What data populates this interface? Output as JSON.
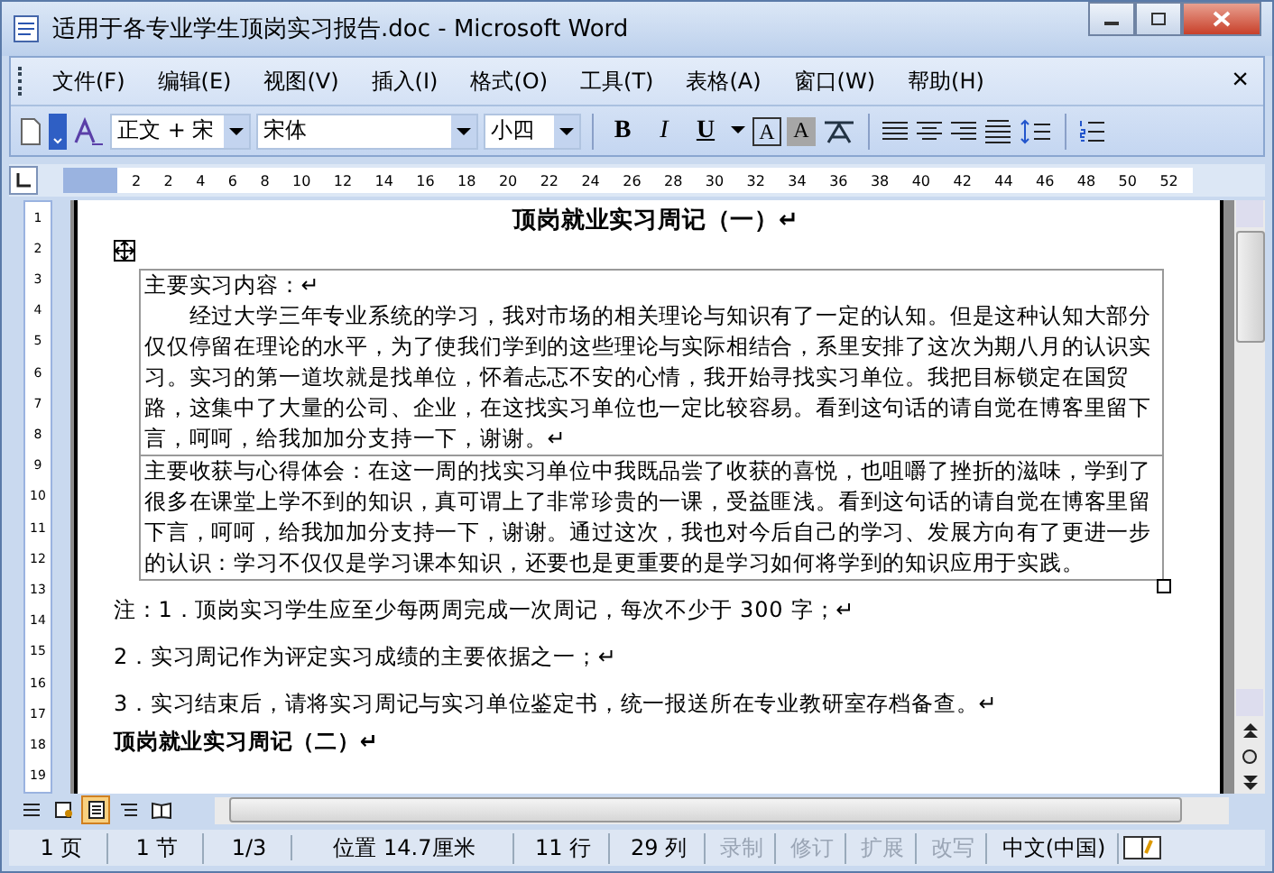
{
  "window": {
    "title": "适用于各专业学生顶岗实习报告.doc - Microsoft Word"
  },
  "menu": [
    {
      "label": "文件(F)"
    },
    {
      "label": "编辑(E)"
    },
    {
      "label": "视图(V)"
    },
    {
      "label": "插入(I)"
    },
    {
      "label": "格式(O)"
    },
    {
      "label": "工具(T)"
    },
    {
      "label": "表格(A)"
    },
    {
      "label": "窗口(W)"
    },
    {
      "label": "帮助(H)"
    }
  ],
  "menu_close": "×",
  "toolbar": {
    "style": "正文 + 宋",
    "font": "宋体",
    "size": "小四",
    "bold": "B",
    "italic": "I",
    "underline": "U",
    "char_border": "A",
    "char_shading": "A"
  },
  "ruler": {
    "ticks": [
      "2",
      "2",
      "4",
      "6",
      "8",
      "10",
      "12",
      "14",
      "16",
      "18",
      "20",
      "22",
      "24",
      "26",
      "28",
      "30",
      "32",
      "34",
      "36",
      "38",
      "40",
      "42",
      "44",
      "46",
      "48",
      "50",
      "52"
    ]
  },
  "vruler": [
    "1",
    "2",
    "3",
    "4",
    "5",
    "6",
    "7",
    "8",
    "9",
    "10",
    "11",
    "12",
    "13",
    "14",
    "15",
    "16",
    "17",
    "18",
    "19"
  ],
  "document": {
    "heading": "顶岗就业实习周记（一）↵",
    "table": [
      {
        "lines": [
          "主要实习内容：↵",
          "　　经过大学三年专业系统的学习，我对市场的相关理论与知识有了一定的认知。但是这种认知大部分仅仅停留在理论的水平，为了使我们学到的这些理论与实际相结合，系里安排了这次为期八月的认识实习。实习的第一道坎就是找单位，怀着忐忑不安的心情，我开始寻找实习单位。我把目标锁定在国贸路，这集中了大量的公司、企业，在这找实习单位也一定比较容易。看到这句话的请自觉在博客里留下言，呵呵，给我加加分支持一下，谢谢。↵"
        ]
      },
      {
        "lines": [
          "主要收获与心得体会：在这一周的找实习单位中我既品尝了收获的喜悦，也咀嚼了挫折的滋味，学到了很多在课堂上学不到的知识，真可谓上了非常珍贵的一课，受益匪浅。看到这句话的请自觉在博客里留下言，呵呵，给我加加分支持一下，谢谢。通过这次，我也对今后自己的学习、发展方向有了更进一步的认识：学习不仅仅是学习课本知识，还要也是更重要的是学习如何将学到的知识应用于实践。"
        ]
      }
    ],
    "notes": [
      "注：1．顶岗实习学生应至少每两周完成一次周记，每次不少于 300 字；↵",
      "2．实习周记作为评定实习成绩的主要依据之一；↵",
      "3．实习结束后，请将实习周记与实习单位鉴定书，统一报送所在专业教研室存档备查。↵"
    ],
    "next_heading": "顶岗就业实习周记（二）↵"
  },
  "view_buttons": [
    {
      "kind": "normal",
      "selected": false
    },
    {
      "kind": "web",
      "selected": false
    },
    {
      "kind": "page",
      "selected": true
    },
    {
      "kind": "outline",
      "selected": false
    },
    {
      "kind": "reading",
      "selected": false
    }
  ],
  "status_bar": [
    {
      "text": "1 页",
      "disabled": false
    },
    {
      "text": "1 节",
      "disabled": false
    },
    {
      "text": "1/3",
      "disabled": false
    },
    {
      "text": "位置 14.7厘米",
      "disabled": false
    },
    {
      "text": "11 行",
      "disabled": false
    },
    {
      "text": "29 列",
      "disabled": false
    },
    {
      "text": "录制",
      "disabled": true
    },
    {
      "text": "修订",
      "disabled": true
    },
    {
      "text": "扩展",
      "disabled": true
    },
    {
      "text": "改写",
      "disabled": true
    },
    {
      "text": "中文(中国)",
      "disabled": false
    }
  ]
}
